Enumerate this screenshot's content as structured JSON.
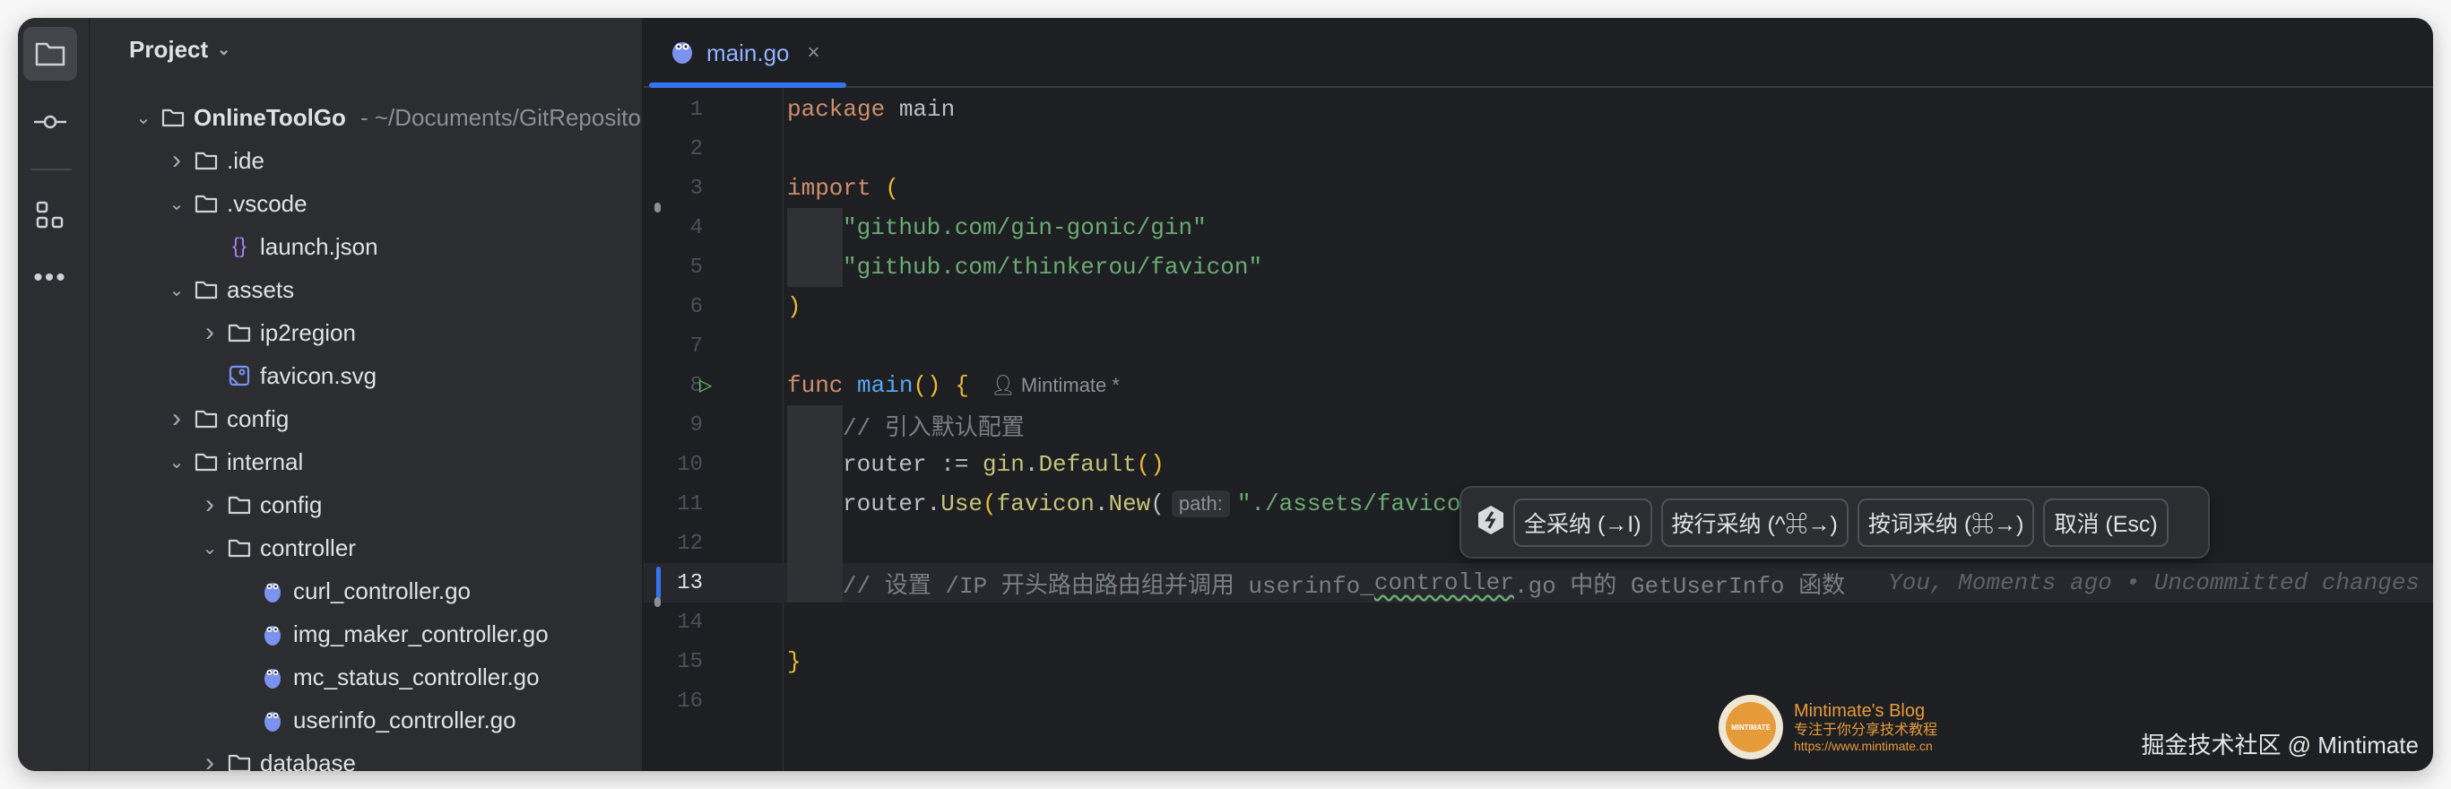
{
  "sidebar": {
    "title": "Project",
    "root_hint": "- ~/Documents/GitReposito",
    "tree": [
      {
        "label": "OnlineToolGo",
        "depth": 0,
        "kind": "folder",
        "state": "open",
        "bold": true
      },
      {
        "label": ".ide",
        "depth": 1,
        "kind": "folder",
        "state": "closed"
      },
      {
        "label": ".vscode",
        "depth": 1,
        "kind": "folder",
        "state": "open"
      },
      {
        "label": "launch.json",
        "depth": 2,
        "kind": "json"
      },
      {
        "label": "assets",
        "depth": 1,
        "kind": "folder",
        "state": "open"
      },
      {
        "label": "ip2region",
        "depth": 2,
        "kind": "folder",
        "state": "closed"
      },
      {
        "label": "favicon.svg",
        "depth": 2,
        "kind": "image"
      },
      {
        "label": "config",
        "depth": 1,
        "kind": "folder",
        "state": "closed"
      },
      {
        "label": "internal",
        "depth": 1,
        "kind": "folder",
        "state": "open"
      },
      {
        "label": "config",
        "depth": 2,
        "kind": "folder",
        "state": "closed"
      },
      {
        "label": "controller",
        "depth": 2,
        "kind": "folder",
        "state": "open"
      },
      {
        "label": "curl_controller.go",
        "depth": 3,
        "kind": "go"
      },
      {
        "label": "img_maker_controller.go",
        "depth": 3,
        "kind": "go"
      },
      {
        "label": "mc_status_controller.go",
        "depth": 3,
        "kind": "go"
      },
      {
        "label": "userinfo_controller.go",
        "depth": 3,
        "kind": "go"
      },
      {
        "label": "database",
        "depth": 2,
        "kind": "folder",
        "state": "closed"
      }
    ]
  },
  "activity": [
    "folder-icon",
    "commit-icon",
    "structure-icon",
    "more-icon"
  ],
  "tab": {
    "label": "main.go",
    "close": "×"
  },
  "colors": {
    "kw": "#cf8e6d",
    "str": "#6aab73",
    "fn": "#56a8f5",
    "pkg": "#c5c47a",
    "txt": "#bcbec4",
    "cmt": "#7a7e85",
    "br": "#e8ba36"
  },
  "code": [
    {
      "n": "1",
      "tokens": [
        [
          "package",
          "kw"
        ],
        [
          " main",
          "txt"
        ]
      ]
    },
    {
      "n": "2",
      "tokens": []
    },
    {
      "n": "3",
      "tokens": [
        [
          "import ",
          "kw"
        ],
        [
          "(",
          "br"
        ]
      ]
    },
    {
      "n": "4",
      "indent": 1,
      "tokens": [
        [
          "\"github.com/gin-gonic/gin\"",
          "str"
        ]
      ]
    },
    {
      "n": "5",
      "indent": 1,
      "tokens": [
        [
          "\"github.com/thinkerou/favicon\"",
          "str"
        ]
      ]
    },
    {
      "n": "6",
      "tokens": [
        [
          ")",
          "br"
        ]
      ]
    },
    {
      "n": "7",
      "tokens": []
    },
    {
      "n": "8",
      "run": true,
      "tokens": [
        [
          "func ",
          "kw"
        ],
        [
          "main",
          "fn"
        ],
        [
          "()",
          "br"
        ],
        [
          " {",
          "br"
        ]
      ],
      "inlay": "Mintimate *"
    },
    {
      "n": "9",
      "indent": 1,
      "tokens": [
        [
          "// 引入默认配置",
          "cmt"
        ]
      ]
    },
    {
      "n": "10",
      "indent": 1,
      "tokens": [
        [
          "router := ",
          "txt"
        ],
        [
          "gin",
          "pkg"
        ],
        [
          ".",
          "txt"
        ],
        [
          "Default",
          "pkg"
        ],
        [
          "()",
          "br"
        ]
      ]
    },
    {
      "n": "11",
      "indent": 1,
      "tokens": [
        [
          "router.",
          "txt"
        ],
        [
          "Use",
          "pkg"
        ],
        [
          "(",
          "br"
        ],
        [
          "favicon",
          "pkg"
        ],
        [
          ".",
          "txt"
        ],
        [
          "New",
          "pkg"
        ],
        [
          "(",
          "txt"
        ],
        [
          "@param",
          ""
        ],
        [
          "\"./assets/favico",
          "str"
        ]
      ],
      "param": "path:"
    },
    {
      "n": "12",
      "indent": 1,
      "tokens": []
    },
    {
      "n": "13",
      "indent": 1,
      "cur": true,
      "tokens": [
        [
          "// 设置 /IP 开头路由路由组并调用 userinfo_",
          "cmt"
        ],
        [
          "controller",
          "cmt squig"
        ],
        [
          ".go 中的 GetUserInfo 函数",
          "cmt"
        ]
      ],
      "blame": "You, Moments ago • Uncommitted changes"
    },
    {
      "n": "14",
      "tokens": []
    },
    {
      "n": "15",
      "tokens": [
        [
          "}",
          "br"
        ]
      ]
    },
    {
      "n": "16",
      "tokens": []
    }
  ],
  "popup": {
    "buttons": [
      "全采纳 (→I)",
      "按行采纳 (^⌘→)",
      "按词采纳 (⌘→)",
      "取消 (Esc)"
    ]
  },
  "watermark": {
    "logo_text": "MINTIMATE",
    "title": "Mintimate's Blog",
    "subtitle": "专注于你分享技术教程",
    "url": "https://www.mintimate.cn"
  },
  "credit": "掘金技术社区 @ Mintimate"
}
